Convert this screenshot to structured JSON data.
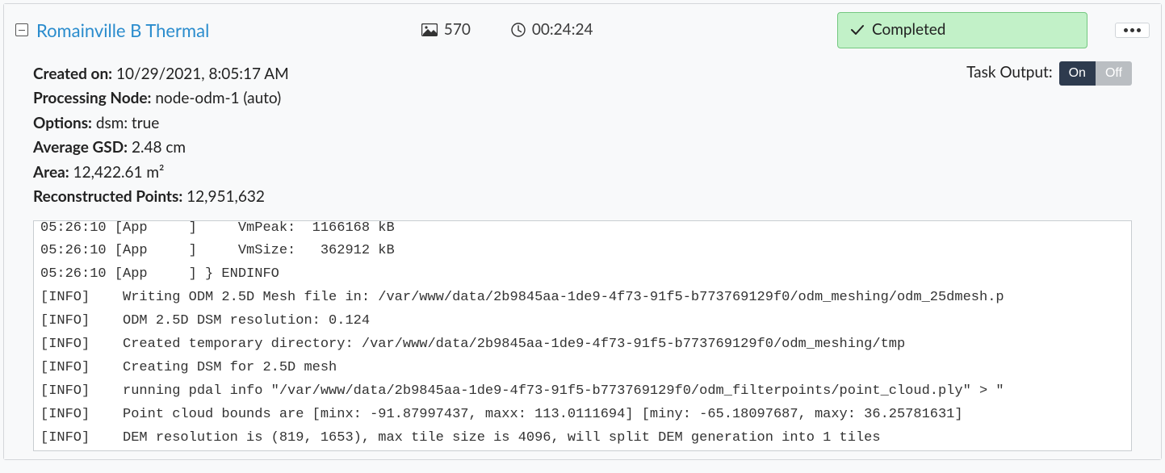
{
  "task": {
    "title": "Romainville B Thermal",
    "image_count": "570",
    "duration": "00:24:24",
    "status_label": "Completed"
  },
  "details": {
    "created_on_label": "Created on:",
    "created_on_value": "10/29/2021, 8:05:17 AM",
    "processing_node_label": "Processing Node:",
    "processing_node_value": "node-odm-1 (auto)",
    "options_label": "Options:",
    "options_value": "dsm: true",
    "avg_gsd_label": "Average GSD:",
    "avg_gsd_value": "2.48 cm",
    "area_label": "Area:",
    "area_value": "12,422.61 m²",
    "recon_points_label": "Reconstructed Points:",
    "recon_points_value": "12,951,632"
  },
  "output": {
    "label": "Task Output:",
    "on": "On",
    "off": "Off",
    "lines": "05:26:10 [App     ]     VmPeak:  1166168 kB\n05:26:10 [App     ]     VmSize:   362912 kB\n05:26:10 [App     ] } ENDINFO\n[INFO]    Writing ODM 2.5D Mesh file in: /var/www/data/2b9845aa-1de9-4f73-91f5-b773769129f0/odm_meshing/odm_25dmesh.p\n[INFO]    ODM 2.5D DSM resolution: 0.124\n[INFO]    Created temporary directory: /var/www/data/2b9845aa-1de9-4f73-91f5-b773769129f0/odm_meshing/tmp\n[INFO]    Creating DSM for 2.5D mesh\n[INFO]    running pdal info \"/var/www/data/2b9845aa-1de9-4f73-91f5-b773769129f0/odm_filterpoints/point_cloud.ply\" > \"\n[INFO]    Point cloud bounds are [minx: -91.87997437, maxx: 113.0111694] [miny: -65.18097687, maxy: 36.25781631]\n[INFO]    DEM resolution is (819, 1653), max tile size is 4096, will split DEM generation into 1 tiles"
  }
}
